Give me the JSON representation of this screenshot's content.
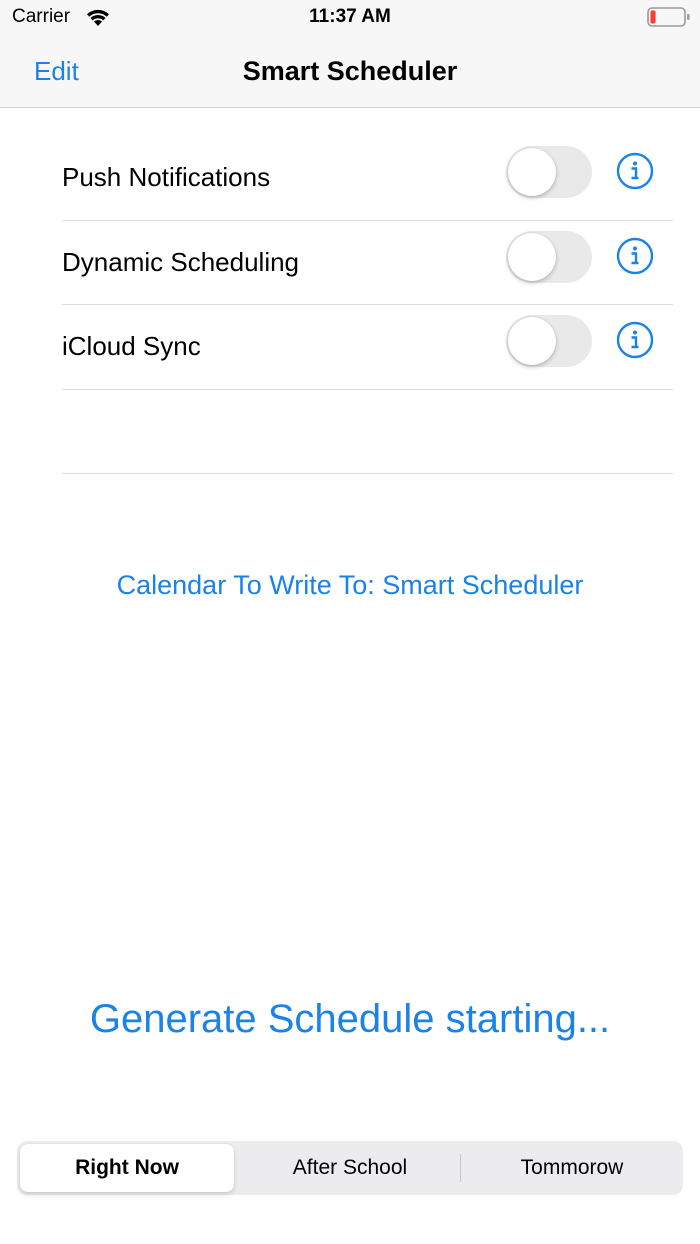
{
  "status_bar": {
    "carrier": "Carrier",
    "time": "11:37 AM",
    "wifi_icon": "wifi-icon",
    "battery_icon": "battery-low-icon",
    "battery_color": "#ff3b30"
  },
  "nav": {
    "edit_label": "Edit",
    "title": "Smart Scheduler"
  },
  "settings": {
    "items": [
      {
        "label": "Push Notifications",
        "enabled": false,
        "info_icon": "info-icon"
      },
      {
        "label": "Dynamic Scheduling",
        "enabled": false,
        "info_icon": "info-icon"
      },
      {
        "label": "iCloud Sync",
        "enabled": false,
        "info_icon": "info-icon"
      }
    ]
  },
  "calendar_link": "Calendar To Write To: Smart Scheduler",
  "generate_link": "Generate Schedule starting...",
  "segments": {
    "options": [
      "Right Now",
      "After School",
      "Tommorow"
    ],
    "selected": "Right Now"
  },
  "colors": {
    "accent": "#1a82e8",
    "toggle_off": "#e9e9ea"
  }
}
